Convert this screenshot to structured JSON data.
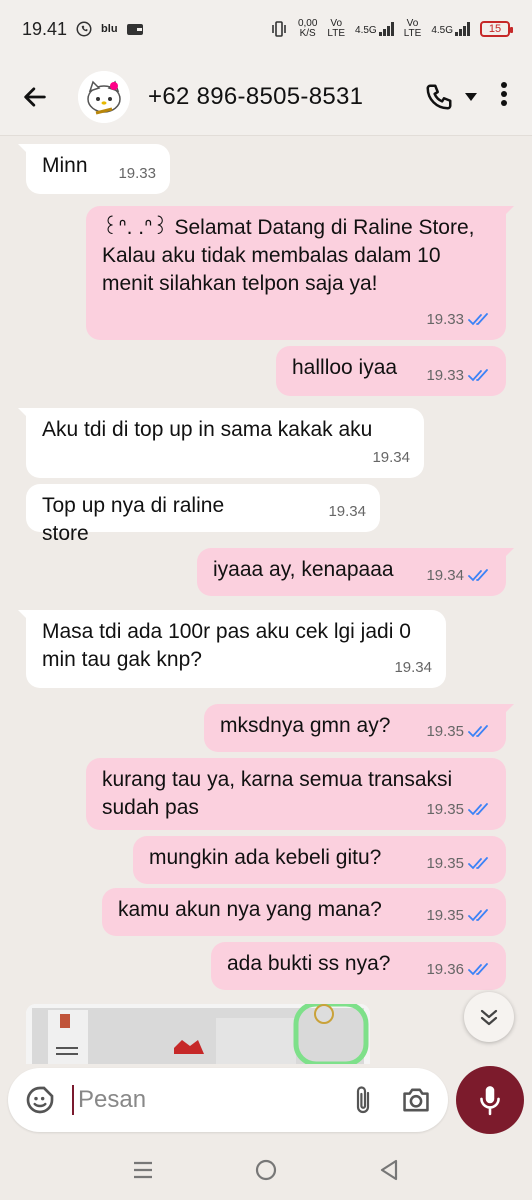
{
  "status_bar": {
    "time": "19.41",
    "carrier_badge": "blu",
    "speed_value": "0,00",
    "speed_unit": "K/S",
    "sim1_top": "Vo",
    "sim1_bottom": "LTE",
    "sim1_net": "4.5G",
    "sim2_top": "Vo",
    "sim2_bottom": "LTE",
    "sim2_net": "4.5G",
    "battery": "15",
    "battery_color": "#c62828"
  },
  "header": {
    "contact": "+62 896-8505-8531"
  },
  "messages": [
    {
      "dir": "in",
      "text": "Minn",
      "time": "19.33"
    },
    {
      "dir": "out",
      "text": "꒰ᐢ. .ᐢ꒱ Selamat Datang di Raline Store, Kalau aku tidak membalas dalam 10 menit silahkan telpon saja ya!",
      "time": "19.33"
    },
    {
      "dir": "out",
      "text": "hallloo iyaa",
      "time": "19.33"
    },
    {
      "dir": "in",
      "text": "Aku tdi di top up in sama kakak aku",
      "time": "19.34"
    },
    {
      "dir": "in",
      "text": "Top up nya di raline store",
      "time": "19.34"
    },
    {
      "dir": "out",
      "text": "iyaaa ay, kenapaaa",
      "time": "19.34"
    },
    {
      "dir": "in",
      "text": "Masa tdi ada 100r pas aku cek lgi jadi 0 min tau gak knp?",
      "time": "19.34"
    },
    {
      "dir": "out",
      "text": "mksdnya gmn ay?",
      "time": "19.35"
    },
    {
      "dir": "out",
      "text": "kurang tau ya, karna semua transaksi sudah pas",
      "time": "19.35"
    },
    {
      "dir": "out",
      "text": "mungkin ada kebeli gitu?",
      "time": "19.35"
    },
    {
      "dir": "out",
      "text": "kamu akun nya yang mana?",
      "time": "19.35"
    },
    {
      "dir": "out",
      "text": "ada bukti ss nya?",
      "time": "19.36"
    }
  ],
  "composer": {
    "placeholder": "Pesan"
  },
  "colors": {
    "chat_bg": "#efebe7",
    "incoming_bubble": "#ffffff",
    "outgoing_bubble": "#fbd0de",
    "read_ticks": "#3b82f6",
    "mic_button": "#7c1b2c"
  },
  "icons": {
    "back": "arrow-left-icon",
    "call": "phone-icon",
    "call_menu": "caret-down-icon",
    "menu": "more-vert-icon",
    "emoji": "sticker-icon",
    "attach": "paperclip-icon",
    "camera": "camera-icon",
    "mic": "mic-icon",
    "scroll": "double-chevron-down-icon"
  }
}
